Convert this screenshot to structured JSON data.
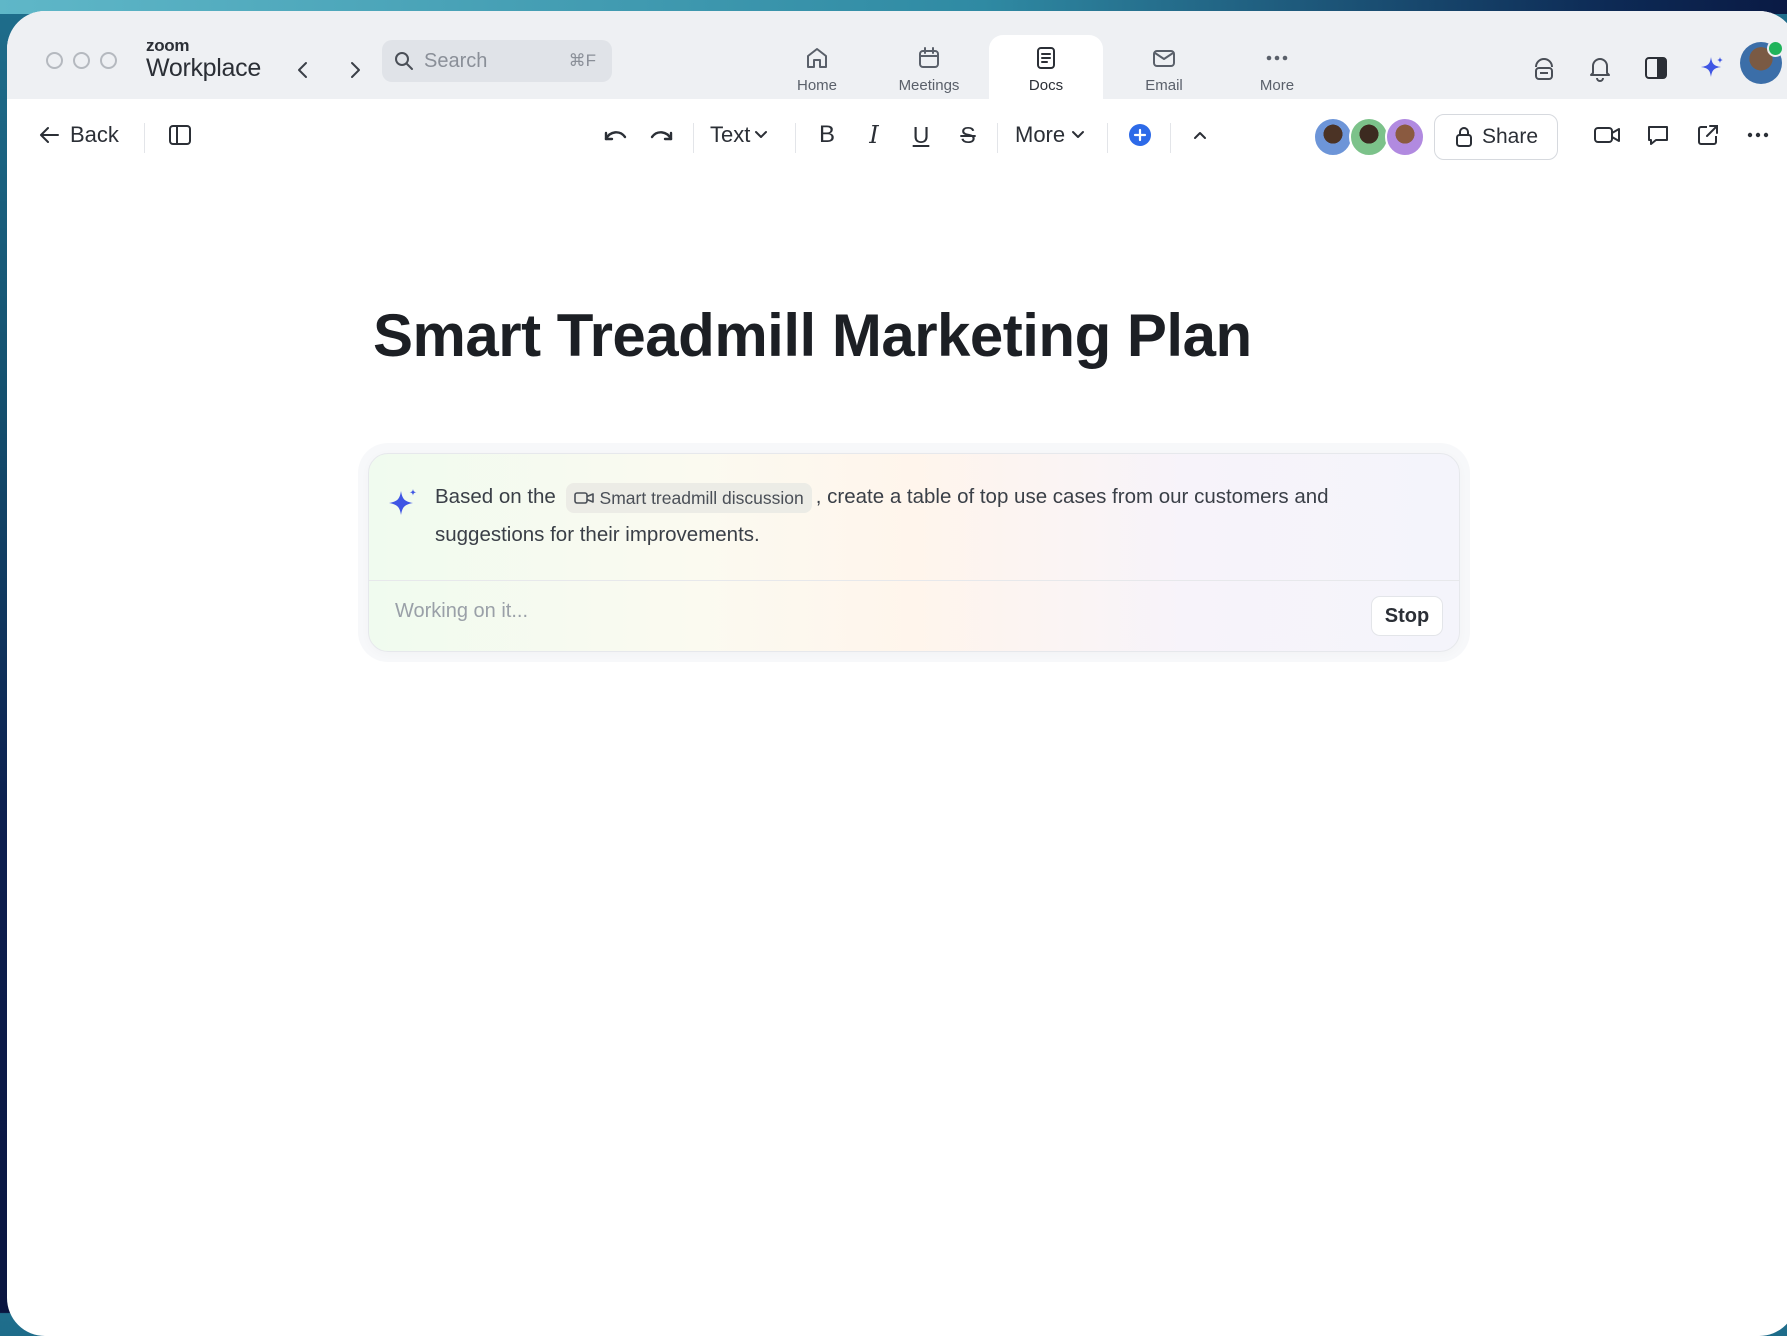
{
  "app": {
    "brand_small": "zoom",
    "brand_big": "Workplace"
  },
  "search": {
    "placeholder": "Search",
    "shortcut": "⌘F"
  },
  "app_tabs": [
    {
      "label": "Home",
      "icon": "home-icon"
    },
    {
      "label": "Meetings",
      "icon": "calendar-icon"
    },
    {
      "label": "Docs",
      "icon": "doc-icon",
      "active": true
    },
    {
      "label": "Email",
      "icon": "mail-icon"
    },
    {
      "label": "More",
      "icon": "more-dots-icon"
    }
  ],
  "toolbar": {
    "back_label": "Back",
    "text_style": "Text",
    "bold": "B",
    "italic": "I",
    "underline": "U",
    "strike": "S",
    "more_label": "More",
    "share_label": "Share"
  },
  "document": {
    "title": "Smart Treadmill Marketing Plan"
  },
  "ai_prompt": {
    "prefix": "Based on the",
    "chip_label": "Smart treadmill discussion",
    "suffix": ", create a table of top use cases from our customers and suggestions for their improvements.",
    "status": "Working on it...",
    "stop_label": "Stop"
  },
  "colors": {
    "accent": "#2d6ae8",
    "ai_star": "#3f56e4",
    "online": "#1fb35a"
  }
}
